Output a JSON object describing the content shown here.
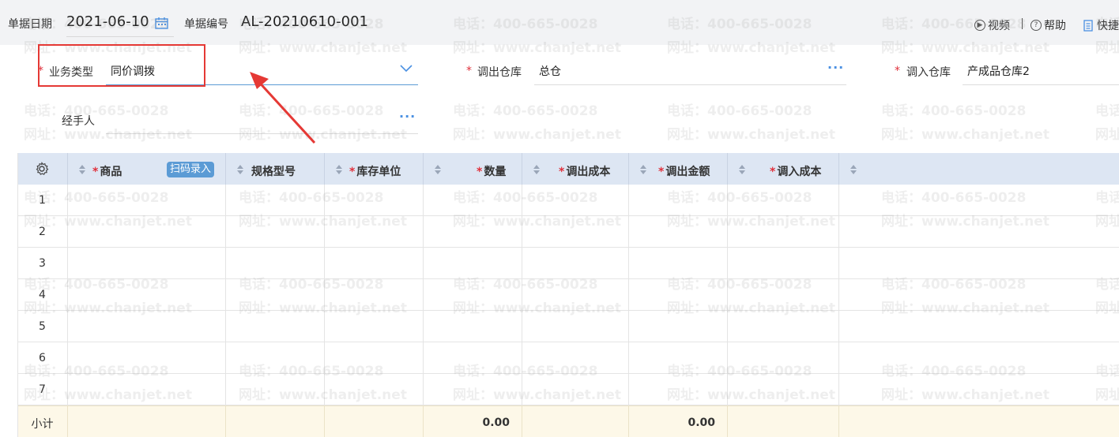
{
  "header": {
    "date_label": "单据日期",
    "date_value": "2021-06-10",
    "code_label": "单据编号",
    "code_value": "AL-20210610-001",
    "video_label": "视频",
    "help_label": "帮助",
    "quick_label": "快捷"
  },
  "form": {
    "business_type": {
      "label": "业务类型",
      "value": "同价调拨"
    },
    "out_warehouse": {
      "label": "调出仓库",
      "value": "总仓"
    },
    "in_warehouse": {
      "label": "调入仓库",
      "value": "产成品仓库2"
    },
    "handler": {
      "label": "经手人",
      "value": ""
    },
    "required_mark": "*"
  },
  "table": {
    "scan_button": "扫码录入",
    "columns": [
      {
        "label": "商品",
        "required": true
      },
      {
        "label": "规格型号",
        "required": false
      },
      {
        "label": "库存单位",
        "required": true
      },
      {
        "label": "数量",
        "required": true
      },
      {
        "label": "调出成本",
        "required": true
      },
      {
        "label": "调出金额",
        "required": true
      },
      {
        "label": "调入成本",
        "required": true
      }
    ],
    "rows": [
      "1",
      "2",
      "3",
      "4",
      "5",
      "6",
      "7"
    ],
    "footer": {
      "label": "小计",
      "quantity_total": "0.00",
      "amount_total": "0.00"
    }
  },
  "watermark": {
    "phone": "电话：400-665-0028",
    "site": "网址：www.chanjet.net"
  },
  "colors": {
    "accent": "#5b9bd5",
    "required": "#e0303b",
    "header_bg": "#dde6f3",
    "footer_bg": "#fdf8e8",
    "highlight": "#e53935"
  }
}
